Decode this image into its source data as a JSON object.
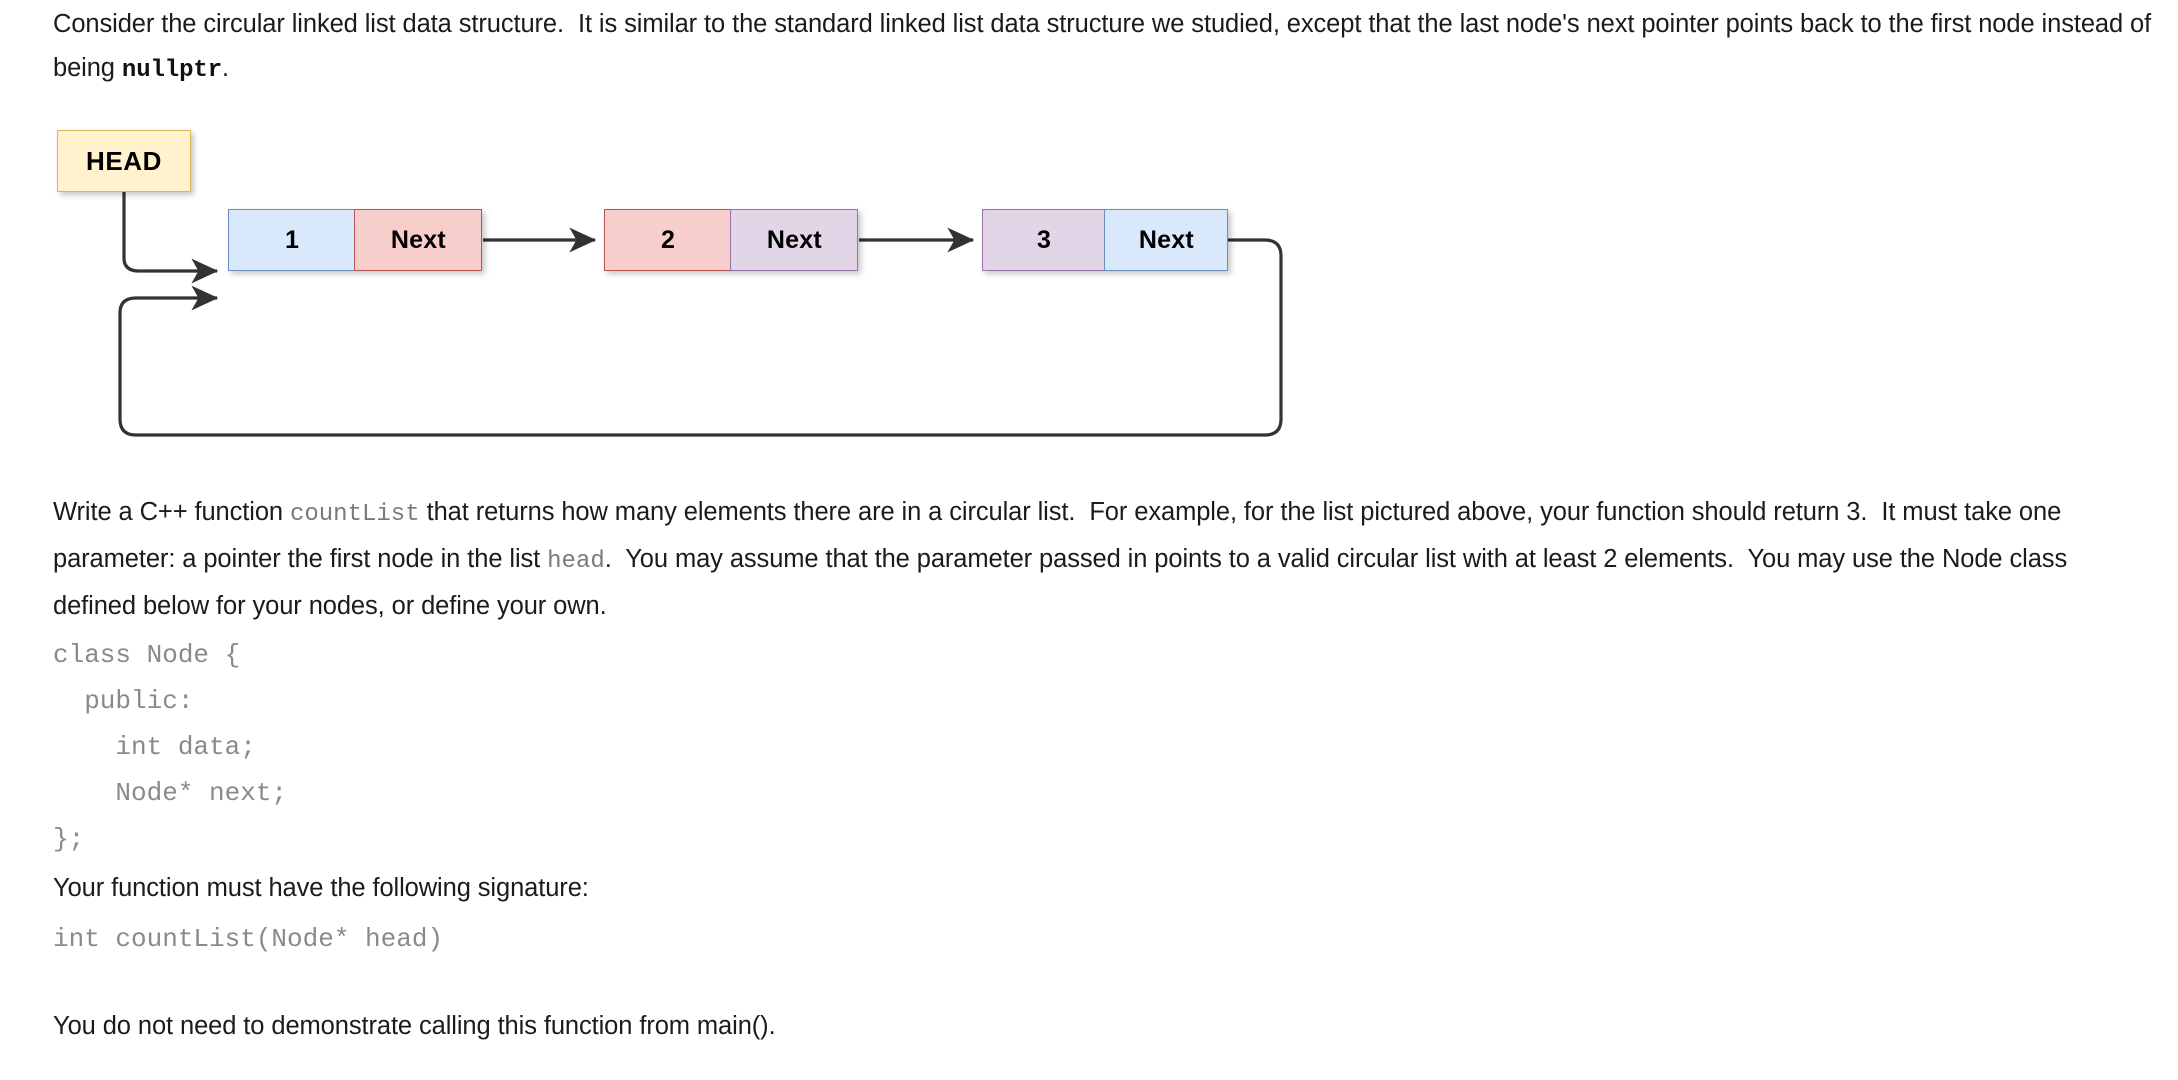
{
  "document": {
    "paragraph_1": {
      "part_a": "Consider the circular linked list data structure.  It is similar to the standard linked list data structure we studied, except that the last node's next pointer points back to the first node instead of being ",
      "code_nullptr": "nullptr",
      "part_b": "."
    },
    "paragraph_2": {
      "part_a": "Write a C++ function ",
      "code_countlist": "countList",
      "part_b": " that returns how many elements there are in a circular list.  For example, for the list pictured above, your function should return 3.  It must take one parameter: a pointer the first node in the list ",
      "code_head": "head",
      "part_c": ".  You may assume that the parameter passed in points to a valid circular list with at least 2 elements.  You may use the Node class defined below for your nodes, or define your own."
    },
    "code_block": "class Node {\n  public:\n    int data;\n    Node* next;\n};",
    "paragraph_3": "Your function must have the following signature:",
    "signature": "int countList(Node* head)",
    "paragraph_4": "You do not need to demonstrate calling this function from main()."
  },
  "diagram": {
    "head_label": "HEAD",
    "next_label": "Next",
    "nodes": [
      {
        "value": "1",
        "next_label": "Next",
        "data_fill": "#dae8fc",
        "data_stroke": "#6c8ebf",
        "next_fill": "#f8cecc",
        "next_stroke": "#b85450"
      },
      {
        "value": "2",
        "next_label": "Next",
        "data_fill": "#f8cecc",
        "data_stroke": "#b85450",
        "next_fill": "#e1d5e7",
        "next_stroke": "#9673a6"
      },
      {
        "value": "3",
        "next_label": "Next",
        "data_fill": "#e1d5e7",
        "data_stroke": "#9673a6",
        "next_fill": "#dae8fc",
        "next_stroke": "#6c8ebf"
      }
    ],
    "head_fill": "#fff2cc",
    "head_stroke": "#d6b656",
    "arrow_color": "#333333"
  }
}
